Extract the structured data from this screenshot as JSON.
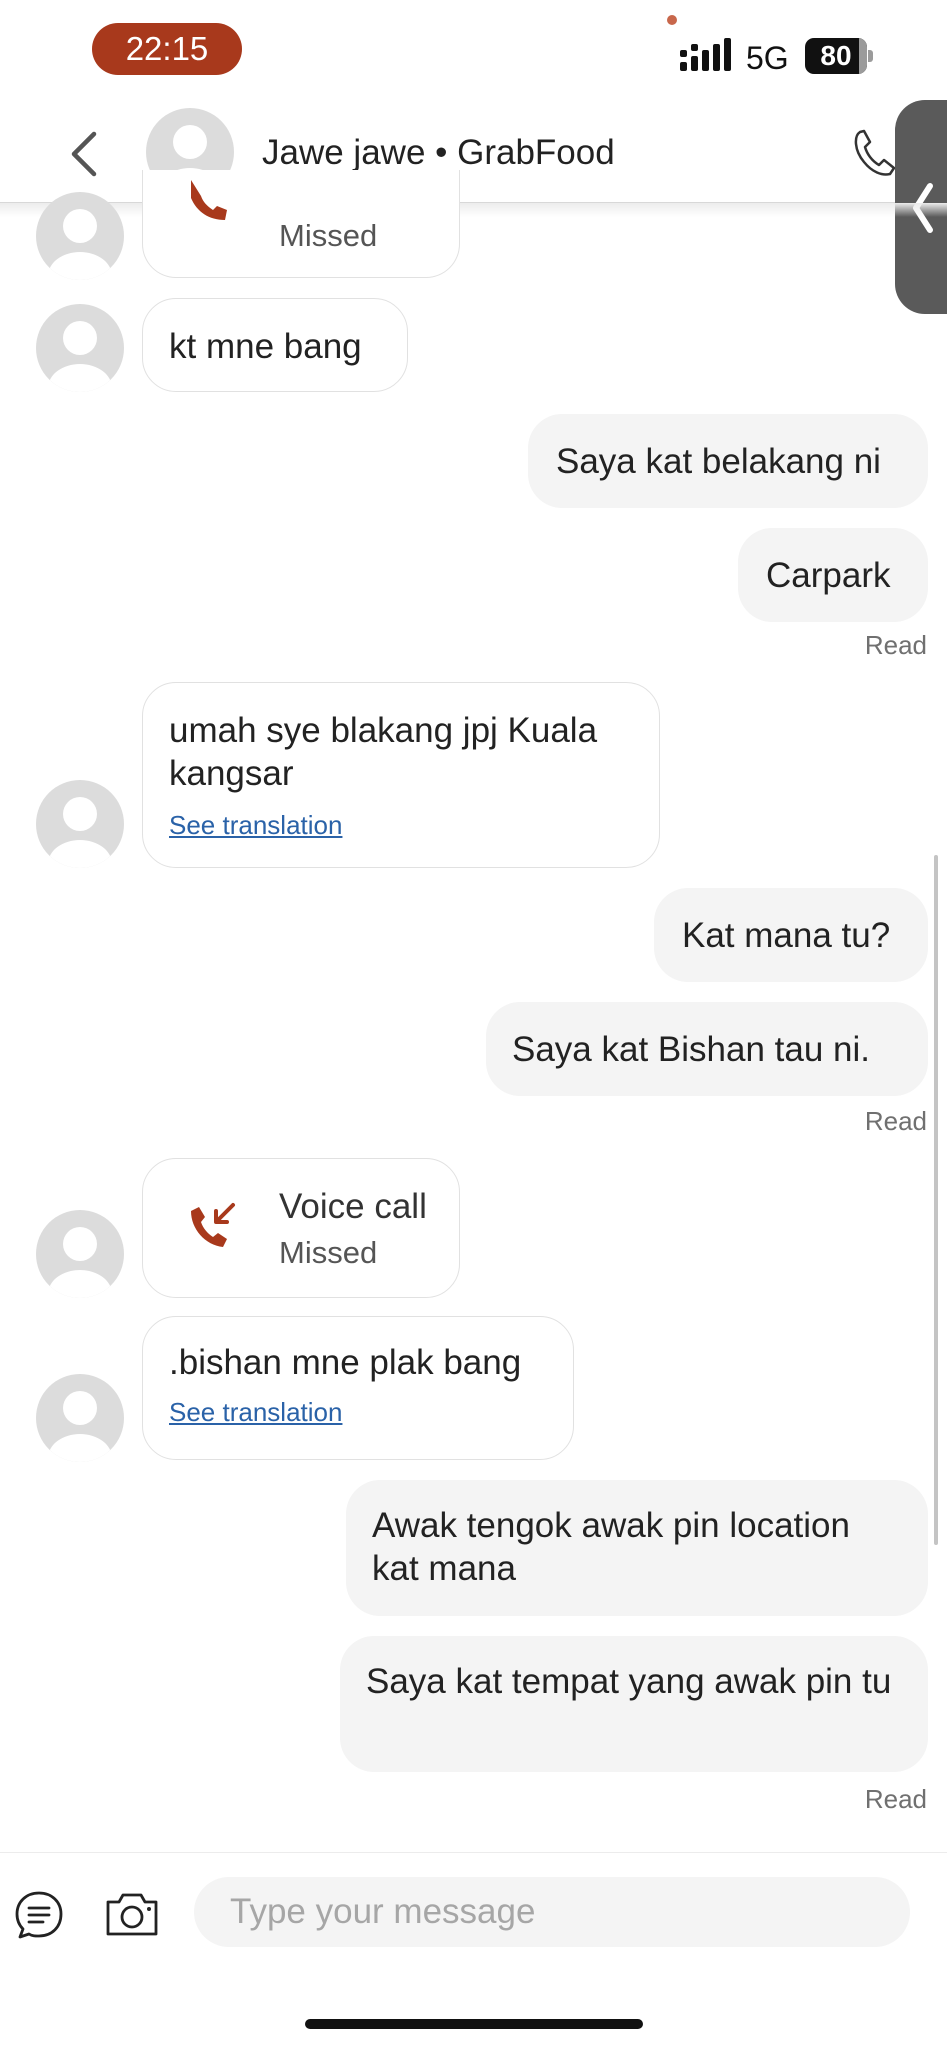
{
  "status_bar": {
    "time": "22:15",
    "network": "5G",
    "battery": "80"
  },
  "header": {
    "contact_name": "Jawe jawe • GrabFood"
  },
  "messages": [
    {
      "kind": "call",
      "sub": "Missed"
    },
    {
      "kind": "in",
      "text": "kt mne bang"
    },
    {
      "kind": "out",
      "text": "Saya kat belakang ni"
    },
    {
      "kind": "out",
      "text": "Carpark",
      "status": "Read"
    },
    {
      "kind": "in",
      "text": "umah sye blakang jpj Kuala kangsar",
      "translate": "See translation"
    },
    {
      "kind": "out",
      "text": "Kat mana tu?"
    },
    {
      "kind": "out",
      "text": "Saya kat Bishan tau ni.",
      "status": "Read"
    },
    {
      "kind": "call",
      "title": "Voice call",
      "sub": "Missed"
    },
    {
      "kind": "in",
      "text": ".bishan mne plak bang",
      "translate": "See translation"
    },
    {
      "kind": "out",
      "text": "Awak tengok awak pin location kat mana"
    },
    {
      "kind": "out",
      "text": "Saya kat tempat yang awak pin tu",
      "status": "Read"
    }
  ],
  "composer": {
    "placeholder": "Type your message"
  },
  "colors": {
    "time_pill": "#a8391c",
    "missed_call_icon": "#a8391c",
    "outgoing_bubble": "#f4f4f4",
    "link": "#2a62a8"
  },
  "icons": [
    "back-chevron-icon",
    "phone-icon",
    "missed-call-icon",
    "chat-list-icon",
    "camera-icon",
    "avatar-placeholder-icon"
  ]
}
